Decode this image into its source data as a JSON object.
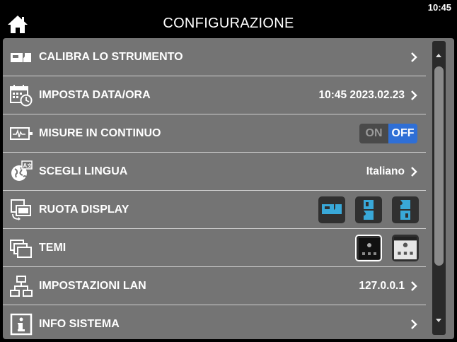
{
  "header": {
    "title": "CONFIGURAZIONE",
    "clock": "10:45",
    "home_icon": "home-icon"
  },
  "rows": [
    {
      "label": "CALIBRA LO STRUMENTO",
      "icon": "calibrate-icon",
      "value": ""
    },
    {
      "label": "IMPOSTA DATA/ORA",
      "icon": "calendar-clock-icon",
      "value": "10:45 2023.02.23"
    },
    {
      "label": "MISURE IN CONTINUO",
      "icon": "waveform-icon",
      "toggle": {
        "on": "ON",
        "off": "OFF",
        "state": "off"
      }
    },
    {
      "label": "SCEGLI LINGUA",
      "icon": "globe-language-icon",
      "value": "Italiano"
    },
    {
      "label": "RUOTA DISPLAY",
      "icon": "rotate-display-icon",
      "options": [
        "rotate-landscape-icon",
        "rotate-portrait-left-icon",
        "rotate-portrait-right-icon"
      ]
    },
    {
      "label": "TEMI",
      "icon": "themes-icon",
      "options": [
        "theme-dark",
        "theme-light"
      ]
    },
    {
      "label": "IMPOSTAZIONI LAN",
      "icon": "network-icon",
      "value": "127.0.0.1"
    },
    {
      "label": "INFO SISTEMA",
      "icon": "info-icon",
      "value": ""
    }
  ],
  "colors": {
    "panel": "#747474",
    "toggle_active": "#2f6fd6",
    "divider": "#cfcfcf"
  }
}
